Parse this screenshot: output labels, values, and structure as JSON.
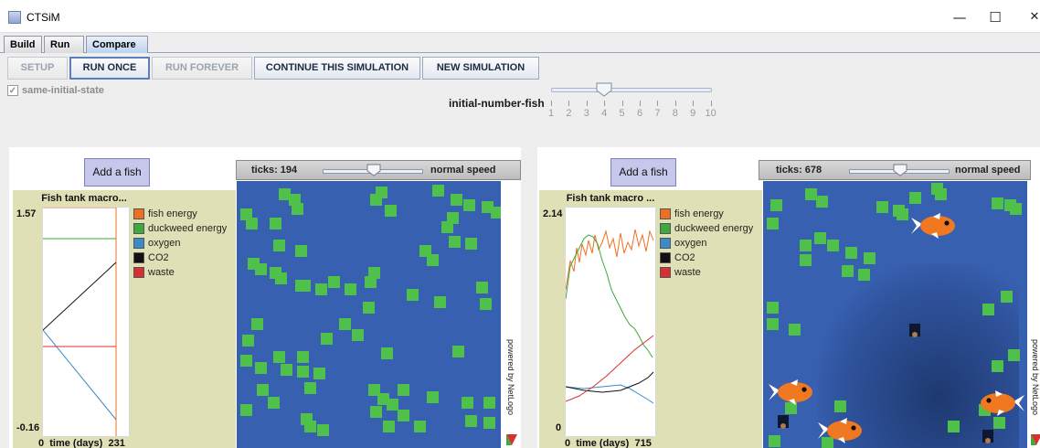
{
  "window": {
    "title": "CTSiM",
    "minimize": "—",
    "maximize": "☐",
    "close": "✕"
  },
  "tabs": [
    {
      "label": "Build",
      "active": false
    },
    {
      "label": "Run",
      "active": false
    },
    {
      "label": "Compare",
      "active": true
    }
  ],
  "toolbar": {
    "setup": "SETUP",
    "run_once": "RUN ONCE",
    "run_forever": "RUN FOREVER",
    "continue": "CONTINUE THIS SIMULATION",
    "new_sim": "NEW SIMULATION"
  },
  "same_initial_state": {
    "label": "same-initial-state",
    "checked": true
  },
  "initial_fish_slider": {
    "label": "initial-number-fish",
    "value": 4,
    "min": 1,
    "max": 10,
    "tick_labels": [
      "1",
      "2",
      "3",
      "4",
      "5",
      "6",
      "7",
      "8",
      "9",
      "10"
    ]
  },
  "legend": [
    {
      "name": "fish energy",
      "color": "#f07020"
    },
    {
      "name": "duckweed energy",
      "color": "#3caa3c"
    },
    {
      "name": "oxygen",
      "color": "#3a8cc8"
    },
    {
      "name": "CO2",
      "color": "#111111"
    },
    {
      "name": "waste",
      "color": "#d83030"
    }
  ],
  "left": {
    "add_fish": "Add a fish",
    "plot_title": "Fish tank macro...",
    "y_max": "1.57",
    "y_min": "-0.16",
    "x_min": "0",
    "x_label": "time (days)",
    "x_max": "231",
    "ticks_label": "ticks: 194",
    "speed_label": "normal speed",
    "powered": "powered by NetLogo"
  },
  "right": {
    "add_fish": "Add a fish",
    "plot_title": "Fish tank macro ...",
    "y_max": "2.14",
    "y_min": "0",
    "x_min": "0",
    "x_label": "time (days)",
    "x_max": "715",
    "ticks_label": "ticks: 678",
    "speed_label": "normal speed",
    "powered": "powered by NetLogo"
  },
  "colors": {
    "world_bg": "#3760b0",
    "duckweed": "#4fc14b",
    "fish": "#f07820",
    "plot_bg": "#e0e0b6",
    "add_button": "#c7c7ec"
  }
}
